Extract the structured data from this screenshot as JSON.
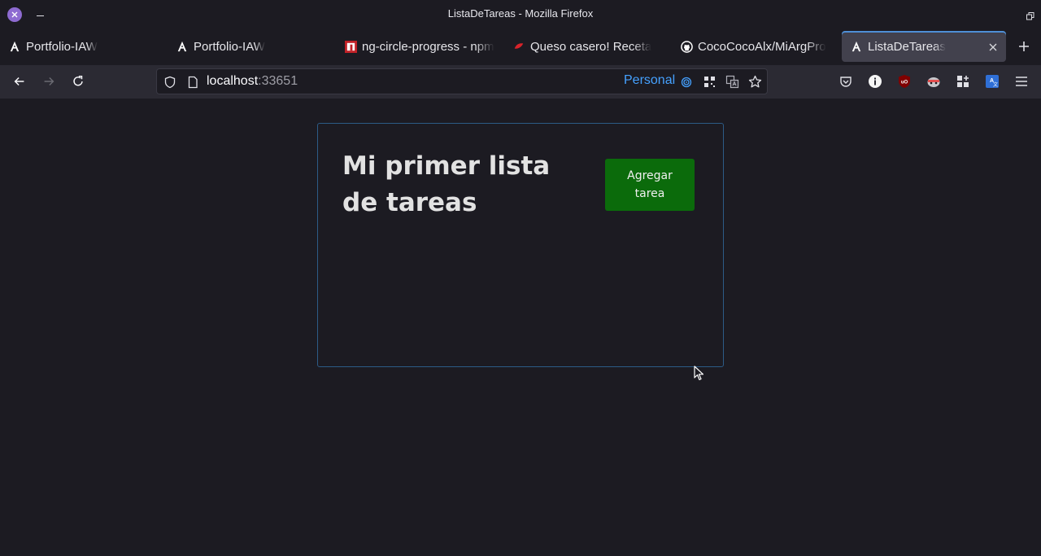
{
  "window": {
    "title": "ListaDeTareas - Mozilla Firefox"
  },
  "tabs": [
    {
      "label": "Portfolio-IAW",
      "icon": "angular-icon",
      "active": false
    },
    {
      "label": "Portfolio-IAW",
      "icon": "angular-icon",
      "active": false
    },
    {
      "label": "ng-circle-progress - npm",
      "icon": "npm-icon",
      "active": false
    },
    {
      "label": "Queso casero! Receta",
      "icon": "recipe-icon",
      "active": false
    },
    {
      "label": "CocoCocoAlx/MiArgPro",
      "icon": "github-icon",
      "active": false
    },
    {
      "label": "ListaDeTareas",
      "icon": "angular-icon",
      "active": true
    }
  ],
  "urlbar": {
    "host": "localhost",
    "port": ":33651",
    "container": "Personal"
  },
  "colors": {
    "accent": "#45a1ff",
    "button_bg": "#0b6b0b",
    "card_border": "#2c5b86",
    "page_bg": "#1c1b22"
  },
  "page": {
    "title": "Mi primer lista de tareas",
    "add_button": "Agregar tarea"
  }
}
